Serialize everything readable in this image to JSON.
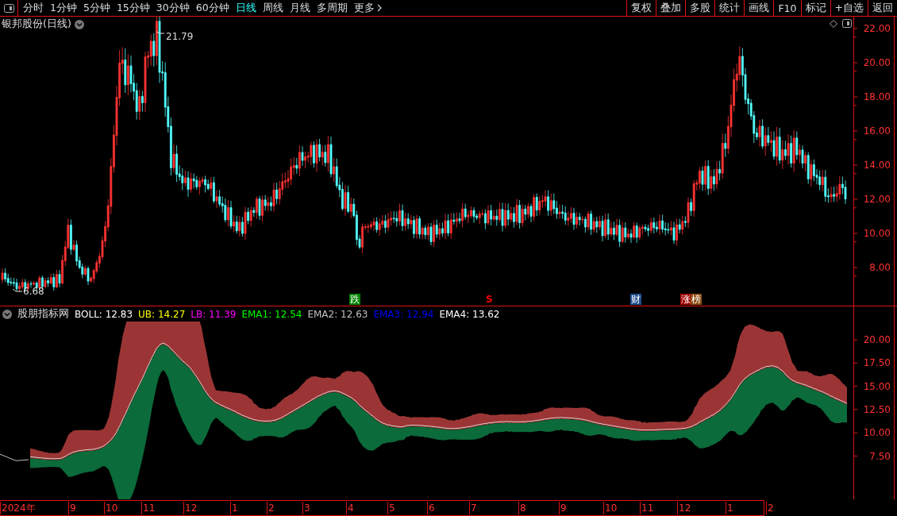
{
  "toolbar": {
    "tabs": [
      {
        "label": "分时",
        "selected": false
      },
      {
        "label": "1分钟",
        "selected": false
      },
      {
        "label": "5分钟",
        "selected": false
      },
      {
        "label": "15分钟",
        "selected": false
      },
      {
        "label": "30分钟",
        "selected": false
      },
      {
        "label": "60分钟",
        "selected": false
      },
      {
        "label": "日线",
        "selected": true
      },
      {
        "label": "周线",
        "selected": false
      },
      {
        "label": "月线",
        "selected": false
      },
      {
        "label": "多周期",
        "selected": false
      }
    ],
    "more_menu": {
      "label": "更多"
    },
    "buttons": [
      "复权",
      "叠加",
      "多股",
      "统计",
      "画线",
      "F10",
      "标记",
      "+自选",
      "返回"
    ]
  },
  "price_chart": {
    "title": "银邦股份(日线)",
    "y_ticks": [
      "22.00",
      "20.00",
      "18.00",
      "16.00",
      "14.00",
      "12.00",
      "10.00",
      "8.00"
    ],
    "annotations": [
      {
        "label": "21.79"
      },
      {
        "label": "6.68"
      }
    ],
    "markers": [
      {
        "kind": "badge",
        "text": "跌",
        "color": "#008000"
      },
      {
        "kind": "letter",
        "text": "S",
        "color": "#ff0000"
      },
      {
        "kind": "badge",
        "text": "财",
        "color": "#1f4e8c"
      },
      {
        "kind": "badge",
        "text": "涨",
        "color": "#a00000"
      },
      {
        "kind": "badge",
        "text": "榜",
        "color": "#8b4c10"
      }
    ]
  },
  "indicator": {
    "title": "股朋指标网",
    "legend": [
      {
        "label": "BOLL: 12.83",
        "color": "#ffffff"
      },
      {
        "label": "UB: 14.27",
        "color": "#ffff00"
      },
      {
        "label": "LB: 11.39",
        "color": "#ff00ff"
      },
      {
        "label": "EMA1: 12.54",
        "color": "#00ff00"
      },
      {
        "label": "EMA2: 12.63",
        "color": "#c0c0c0"
      },
      {
        "label": "EMA3: 12.94",
        "color": "#0000ff"
      },
      {
        "label": "EMA4: 13.62",
        "color": "#ffffff"
      }
    ],
    "y_ticks": [
      "20.00",
      "17.50",
      "15.00",
      "12.50",
      "10.00",
      "7.50"
    ]
  },
  "time_axis": {
    "labels": [
      "2024年",
      "9",
      "10",
      "11",
      "12",
      "1",
      "2",
      "3",
      "4",
      "5",
      "6",
      "7",
      "8",
      "9",
      "10",
      "11",
      "12",
      "1",
      "2"
    ]
  }
}
